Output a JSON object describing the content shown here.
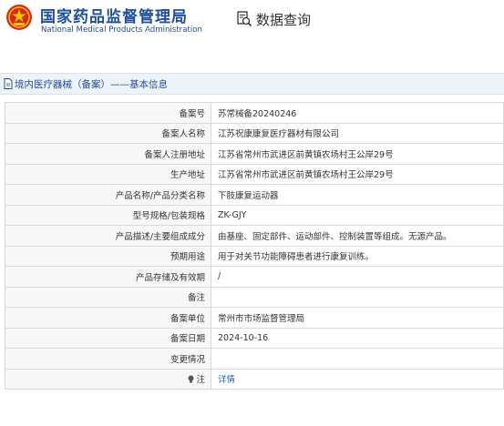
{
  "header": {
    "org_name_cn": "国家药品监督管理局",
    "org_name_en": "National Medical Products Administration",
    "page_title": "数据查询"
  },
  "breadcrumb": {
    "text": "境内医疗器械（备案）——基本信息"
  },
  "record": {
    "rows": [
      {
        "label": "备案号",
        "value": "苏常械备20240246"
      },
      {
        "label": "备案人名称",
        "value": "江苏祝康康复医疗器材有限公司"
      },
      {
        "label": "备案人注册地址",
        "value": "江苏省常州市武进区前黄镇农场村王公岸29号"
      },
      {
        "label": "生产地址",
        "value": "江苏省常州市武进区前黄镇农场村王公岸29号"
      },
      {
        "label": "产品名称/产品分类名称",
        "value": "下肢康复运动器"
      },
      {
        "label": "型号规格/包装规格",
        "value": "ZK-GJY"
      },
      {
        "label": "产品描述/主要组成成分",
        "value": "由基座、固定部件、运动部件、控制装置等组成。无源产品。"
      },
      {
        "label": "预期用途",
        "value": "用于对关节功能障碍患者进行康复训练。"
      },
      {
        "label": "产品存储及有效期",
        "value": "/"
      },
      {
        "label": "备注",
        "value": ""
      },
      {
        "label": "备案单位",
        "value": "常州市市场监督管理局"
      },
      {
        "label": "备案日期",
        "value": "2024-10-16"
      },
      {
        "label": "变更情况",
        "value": ""
      },
      {
        "label": "注",
        "value": "详情"
      }
    ]
  },
  "colors": {
    "brand_blue": "#1f4e9b",
    "emblem_red": "#d52b1e",
    "link_blue": "#1f6ab3"
  },
  "icons": {
    "emblem": "nmpa-emblem-icon",
    "search": "document-search-icon",
    "breadcrumb": "document-icon",
    "note": "bulb-icon"
  }
}
